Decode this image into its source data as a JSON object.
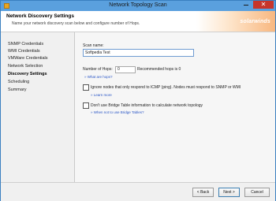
{
  "window": {
    "title": "Network Topology Scan"
  },
  "header": {
    "title": "Network Discovery Settings",
    "subtitle": "Name your network discovery scan below and configure number of Hops.",
    "brand": "solarwinds"
  },
  "sidebar": {
    "items": [
      {
        "label": "SNMP Credentials",
        "active": false
      },
      {
        "label": "WMI Credentials",
        "active": false
      },
      {
        "label": "VMWare Credentials",
        "active": false
      },
      {
        "label": "Network Selection",
        "active": false
      },
      {
        "label": "Discovery Settings",
        "active": true
      },
      {
        "label": "Scheduling",
        "active": false
      },
      {
        "label": "Summary",
        "active": false
      }
    ]
  },
  "main": {
    "scan_name_label": "Scan name:",
    "scan_name_value": "Softpedia Test",
    "hops_label": "Number of Hops:",
    "hops_value": "0",
    "hops_recommended": "Recommended hops is 0",
    "what_are_hops_link": "» What are hops?",
    "ignore_nodes_label": "Ignore nodes that only respond to ICMP (ping). Nodes must respond to SNMP or WMI",
    "ignore_nodes_checked": false,
    "learn_more_link": "» Learn more",
    "bridge_table_label": "Don't use Bridge Table information to calculate network topology",
    "bridge_table_checked": false,
    "bridge_table_link": "» When not to use Bridge Tables?"
  },
  "footer": {
    "back_label": "< Back",
    "next_label": "Next >",
    "cancel_label": "Cancel"
  },
  "colors": {
    "title_bar": "#5aa0de",
    "close_button": "#c7352b",
    "link": "#2a56c6",
    "brand_orange": "#f8b780"
  }
}
